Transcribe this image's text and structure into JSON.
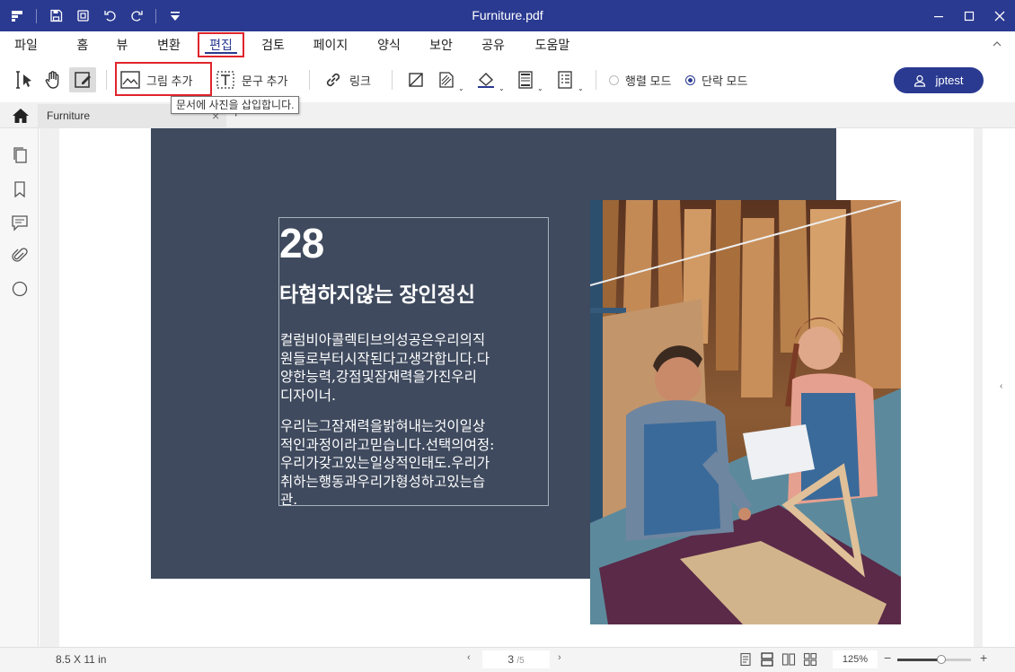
{
  "window": {
    "title": "Furniture.pdf"
  },
  "menu": {
    "items": [
      "파일",
      "홈",
      "뷰",
      "변환",
      "편집",
      "검토",
      "페이지",
      "양식",
      "보안",
      "공유",
      "도움말"
    ],
    "active": "편집"
  },
  "toolbar": {
    "add_image_label": "그림 추가",
    "add_text_label": "문구 추가",
    "link_label": "링크",
    "line_mode_label": "행렬 모드",
    "paragraph_mode_label": "단락 모드",
    "selected_mode": "단락 모드",
    "user_label": "jptest",
    "tooltip": "문서에 사진을 삽입합니다."
  },
  "tabs": {
    "doc_tab_label": "Furniture",
    "close_symbol": "×",
    "add_symbol": "+"
  },
  "document": {
    "number": "28",
    "heading": "타협하지않는 장인정신",
    "para1_lines": [
      "컬럼비아콜렉티브의성공은우리의직",
      "원들로부터시작된다고생각합니다.다",
      "양한능력,강점및잠재력을가진우리",
      "디자이너."
    ],
    "para2_lines": [
      "우리는그잠재력을밝혀내는것이일상",
      "적인과정이라고믿습니다.선택의여정:",
      "우리가갖고있는일상적인태도.우리가",
      "취하는행동과우리가형성하고있는습",
      "관."
    ]
  },
  "status": {
    "page_size": "8.5 X 11 in",
    "current_page": "3",
    "total_pages": "/5",
    "zoom": "125%",
    "zoom_level": 0.6,
    "prev_symbol": "‹",
    "next_symbol": "›",
    "minus_symbol": "−",
    "plus_symbol": "+"
  },
  "colors": {
    "brand": "#2a3a91",
    "highlight": "#e0242b",
    "panel": "#3f4a5e"
  }
}
